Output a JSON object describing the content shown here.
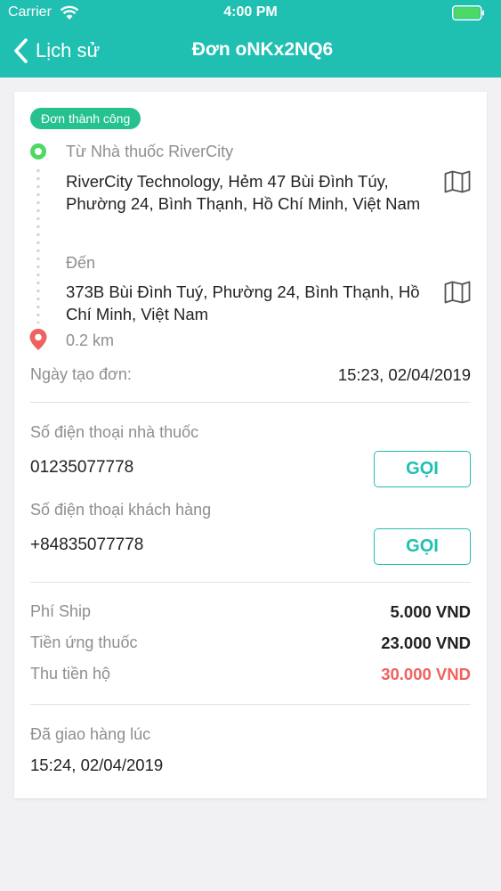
{
  "status_bar": {
    "carrier": "Carrier",
    "time": "4:00 PM"
  },
  "nav": {
    "back_label": "Lịch sử",
    "title": "Đơn oNKx2NQ6"
  },
  "colors": {
    "accent": "#1fbfb1",
    "badge": "#25c28f",
    "start_dot": "#4cd964",
    "end_pin": "#f0625f",
    "collect_amount": "#f0625f"
  },
  "order": {
    "status_badge": "Đơn thành công",
    "from_label": "Từ Nhà thuốc RiverCity",
    "from_address": "RiverCity Technology, Hẻm 47 Bùi Đình Túy, Phường 24, Bình Thạnh, Hồ Chí Minh, Việt Nam",
    "to_label": "Đến",
    "to_address": "373B Bùi Đình Tuý, Phường 24, Bình Thạnh, Hồ Chí Minh, Việt Nam",
    "distance": "0.2 km",
    "created_label": "Ngày tạo đơn:",
    "created_value": "15:23, 02/04/2019"
  },
  "contacts": {
    "pharmacy_label": "Số điện thoại nhà thuốc",
    "pharmacy_phone": "01235077778",
    "customer_label": "Số điện thoại khách hàng",
    "customer_phone": "+84835077778",
    "call_label": "GỌI"
  },
  "fees": {
    "ship_label": "Phí Ship",
    "ship_value": "5.000 VND",
    "advance_label": "Tiền ứng thuốc",
    "advance_value": "23.000 VND",
    "collect_label": "Thu tiền hộ",
    "collect_value": "30.000 VND"
  },
  "delivery": {
    "delivered_label": "Đã giao hàng lúc",
    "delivered_value": "15:24, 02/04/2019"
  },
  "icons": {
    "back": "chevron-left-icon",
    "map": "map-icon",
    "start": "circle-dot-icon",
    "end": "location-pin-icon"
  }
}
